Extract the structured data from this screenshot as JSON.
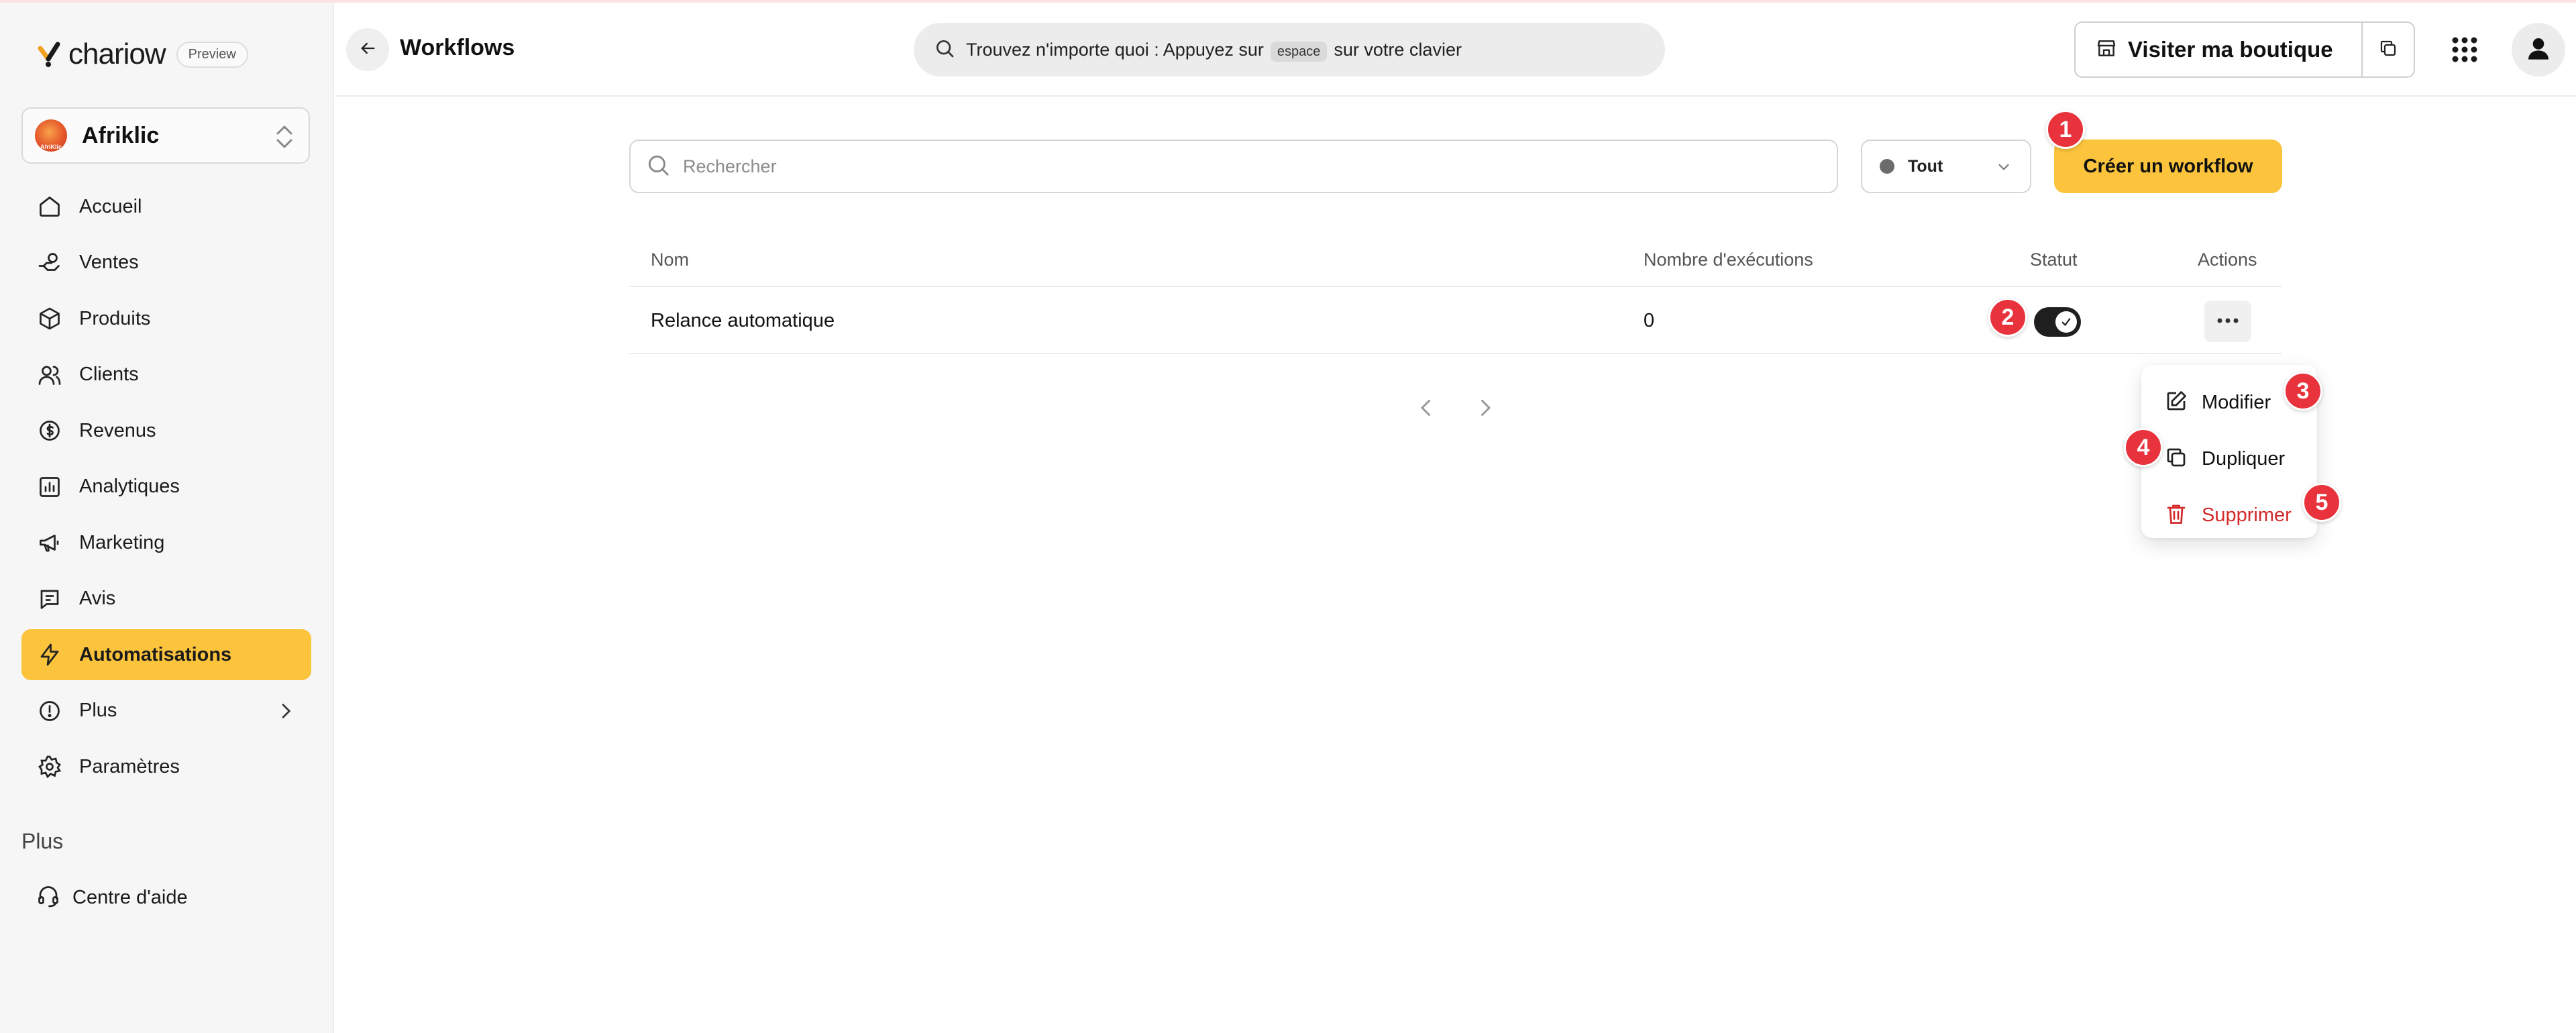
{
  "brand": {
    "name": "chariow",
    "badge": "Preview"
  },
  "store": {
    "name": "Afriklic",
    "logo_text": "AfriKlic"
  },
  "sidebar": {
    "items": [
      {
        "label": "Accueil",
        "icon": "home-icon"
      },
      {
        "label": "Ventes",
        "icon": "hand-coins-icon"
      },
      {
        "label": "Produits",
        "icon": "package-icon"
      },
      {
        "label": "Clients",
        "icon": "users-icon"
      },
      {
        "label": "Revenus",
        "icon": "dollar-circle-icon"
      },
      {
        "label": "Analytiques",
        "icon": "bar-chart-icon"
      },
      {
        "label": "Marketing",
        "icon": "megaphone-icon"
      },
      {
        "label": "Avis",
        "icon": "message-icon"
      },
      {
        "label": "Automatisations",
        "icon": "lightning-icon",
        "active": true
      },
      {
        "label": "Plus",
        "icon": "info-circle-icon"
      },
      {
        "label": "Paramètres",
        "icon": "gear-icon"
      }
    ],
    "section_heading": "Plus",
    "help_label": "Centre d'aide"
  },
  "header": {
    "title": "Workflows",
    "search_before": "Trouvez n'importe quoi : Appuyez sur",
    "search_key": "espace",
    "search_after": "sur votre clavier",
    "visit_label": "Visiter ma boutique"
  },
  "toolbar": {
    "search_placeholder": "Rechercher",
    "filter_value": "Tout",
    "create_label": "Créer un workflow"
  },
  "table": {
    "columns": [
      "Nom",
      "Nombre d'exécutions",
      "Statut",
      "Actions"
    ],
    "rows": [
      {
        "name": "Relance automatique",
        "executions": "0",
        "status_on": true
      }
    ]
  },
  "menu": {
    "edit": "Modifier",
    "duplicate": "Dupliquer",
    "delete": "Supprimer"
  },
  "badges": [
    "1",
    "2",
    "3",
    "4",
    "5"
  ],
  "colors": {
    "accent": "#fbc43c",
    "badge": "#e8333d",
    "danger": "#d32a2a",
    "sidebar_bg": "#f6f6f6"
  }
}
